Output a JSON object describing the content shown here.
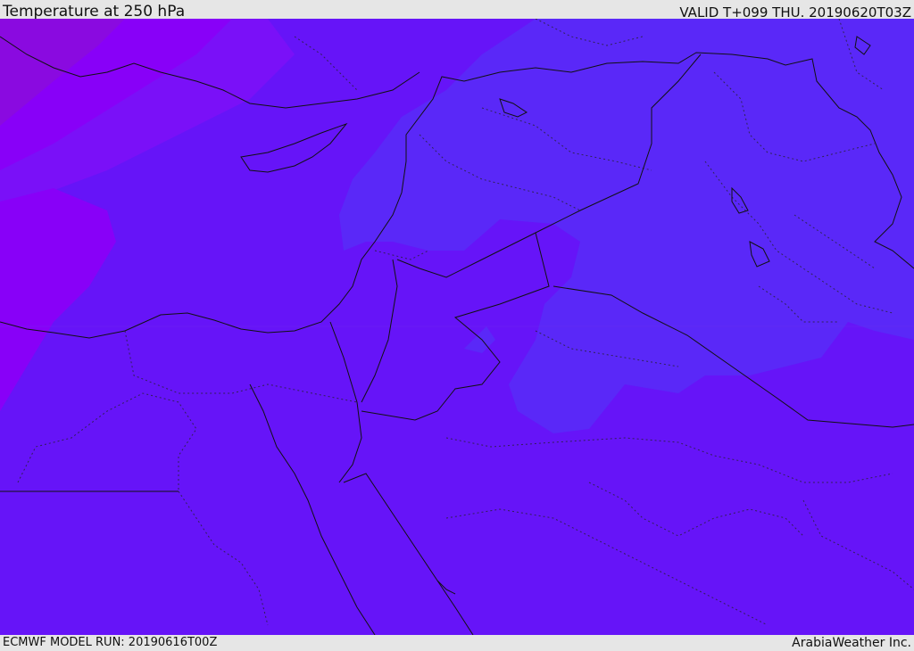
{
  "header": {
    "title": "Temperature at 250 hPa",
    "valid": "VALID T+099 THU. 20190620T03Z"
  },
  "footer": {
    "model_run": "ECMWF MODEL RUN: 20190616T00Z",
    "credit": "ArabiaWeather Inc."
  },
  "colors": {
    "base_fill": "#6614f8",
    "cool_zone": "#5a28f8",
    "warm_zone": "#7a10f8",
    "hot_zone": "#8800f8",
    "corner_zone": "#8a0ae0",
    "border": "#111111"
  }
}
